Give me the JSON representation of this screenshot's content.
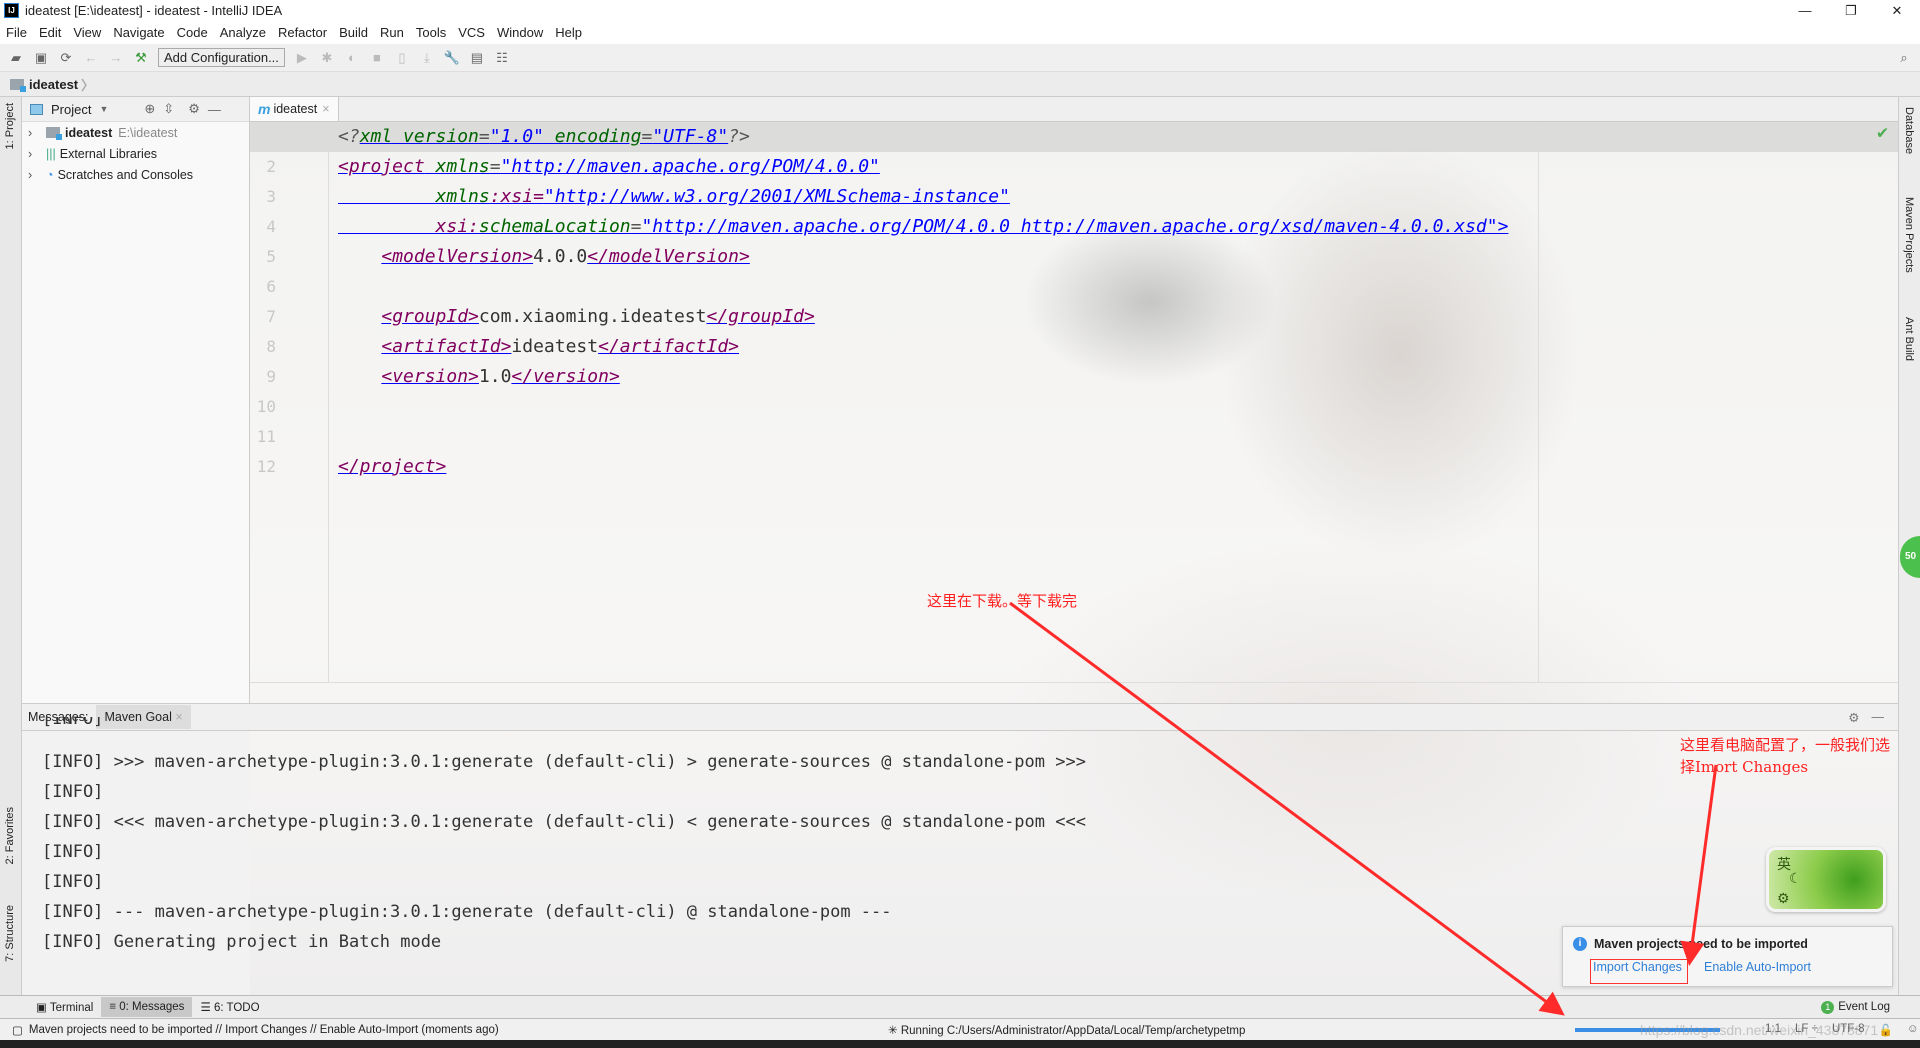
{
  "window": {
    "title": "ideatest [E:\\ideatest] - ideatest - IntelliJ IDEA",
    "logo": "IJ",
    "controls": [
      "—",
      "❐",
      "✕"
    ]
  },
  "menu": [
    "File",
    "Edit",
    "View",
    "Navigate",
    "Code",
    "Analyze",
    "Refactor",
    "Build",
    "Run",
    "Tools",
    "VCS",
    "Window",
    "Help"
  ],
  "toolbar": {
    "add_configuration": "Add Configuration..."
  },
  "breadcrumb": "ideatest",
  "left_stripe": {
    "project": "1: Project",
    "favorites": "2: Favorites",
    "structure": "7: Structure"
  },
  "right_stripe": [
    "Database",
    "Maven Projects",
    "Ant Build"
  ],
  "project_panel": {
    "title": "Project",
    "items": [
      {
        "label": "ideatest",
        "path": "E:\\ideatest"
      },
      {
        "label": "External Libraries"
      },
      {
        "label": "Scratches and Consoles"
      }
    ]
  },
  "editor": {
    "tab": "ideatest",
    "tab_icon": "m",
    "lines": [
      [
        {
          "t": "<?",
          "c": "pi"
        },
        {
          "t": "xml version",
          "c": "attr"
        },
        {
          "t": "=",
          "c": "pi ul"
        },
        {
          "t": "\"1.0\"",
          "c": "val"
        },
        {
          "t": " encoding",
          "c": "attr"
        },
        {
          "t": "=",
          "c": "pi ul"
        },
        {
          "t": "\"UTF-8\"",
          "c": "val"
        },
        {
          "t": "?>",
          "c": "pi"
        }
      ],
      [
        {
          "t": "<project",
          "c": "tag"
        },
        {
          "t": " xmlns",
          "c": "attr"
        },
        {
          "t": "=",
          "c": "pi ul"
        },
        {
          "t": "\"http://maven.apache.org/POM/4.0.0\"",
          "c": "val"
        }
      ],
      [
        {
          "t": "         ",
          "c": "ul"
        },
        {
          "t": "xmlns",
          "c": "attr"
        },
        {
          "t": ":xsi=",
          "c": "tag"
        },
        {
          "t": "\"http://www.w3.org/2001/XMLSchema-instance\"",
          "c": "val"
        }
      ],
      [
        {
          "t": "         ",
          "c": "ul"
        },
        {
          "t": "xsi:",
          "c": "tag"
        },
        {
          "t": "schemaLocation",
          "c": "attr"
        },
        {
          "t": "=",
          "c": "pi ul"
        },
        {
          "t": "\"http://maven.apache.org/POM/4.0.0 http://maven.apache.org/xsd/maven-4.0.0.xsd\">",
          "c": "val"
        }
      ],
      [
        {
          "t": "    ",
          "c": "txt"
        },
        {
          "t": "<modelVersion>",
          "c": "tag"
        },
        {
          "t": "4.0.0",
          "c": "txt"
        },
        {
          "t": "</modelVersion>",
          "c": "tag"
        }
      ],
      [],
      [
        {
          "t": "    ",
          "c": "txt"
        },
        {
          "t": "<groupId>",
          "c": "tag"
        },
        {
          "t": "com.xiaoming.ideatest",
          "c": "txt"
        },
        {
          "t": "</groupId>",
          "c": "tag"
        }
      ],
      [
        {
          "t": "    ",
          "c": "txt"
        },
        {
          "t": "<artifactId>",
          "c": "tag"
        },
        {
          "t": "ideatest",
          "c": "txt"
        },
        {
          "t": "</artifactId>",
          "c": "tag"
        }
      ],
      [
        {
          "t": "    ",
          "c": "txt"
        },
        {
          "t": "<version>",
          "c": "tag"
        },
        {
          "t": "1.0",
          "c": "txt"
        },
        {
          "t": "</version>",
          "c": "tag"
        }
      ],
      [],
      [],
      [
        {
          "t": "</project>",
          "c": "tag"
        }
      ]
    ]
  },
  "messages": {
    "label": "Messages:",
    "tab": "Maven Goal",
    "lines": [
      "[INFO] >>> maven-archetype-plugin:3.0.1:generate (default-cli) > generate-sources @ standalone-pom >>>",
      "[INFO]",
      "[INFO] <<< maven-archetype-plugin:3.0.1:generate (default-cli) < generate-sources @ standalone-pom <<<",
      "[INFO]",
      "[INFO]",
      "[INFO] --- maven-archetype-plugin:3.0.1:generate (default-cli) @ standalone-pom ---",
      "[INFO] Generating project in Batch mode"
    ],
    "partial_top": "[INFO]"
  },
  "bottom_tabs": [
    "Terminal",
    "0: Messages",
    "6: TODO"
  ],
  "event_log": {
    "label": "Event Log",
    "count": "1"
  },
  "status": {
    "message": "Maven projects need to be imported // Import Changes // Enable Auto-Import (moments ago)",
    "running": "Running C:/Users/Administrator/AppData/Local/Temp/archetypetmp",
    "position": "1:1",
    "line_sep": "LF ÷",
    "encoding": "UTF-8",
    "watermark": "https://blog.csdn.net/weixin_43878871"
  },
  "notification": {
    "title": "Maven projects need to be imported",
    "import": "Import Changes",
    "auto": "Enable Auto-Import"
  },
  "ime": {
    "label": "英"
  },
  "side_badge": "50",
  "annotations": {
    "downloading": "这里在下载。等下载完",
    "choose": "这里看电脑配置了，一般我们选",
    "choose2": "择Imort Changes"
  },
  "colors": {
    "annotation": "#ff2020",
    "accent": "#3a8ee6"
  }
}
